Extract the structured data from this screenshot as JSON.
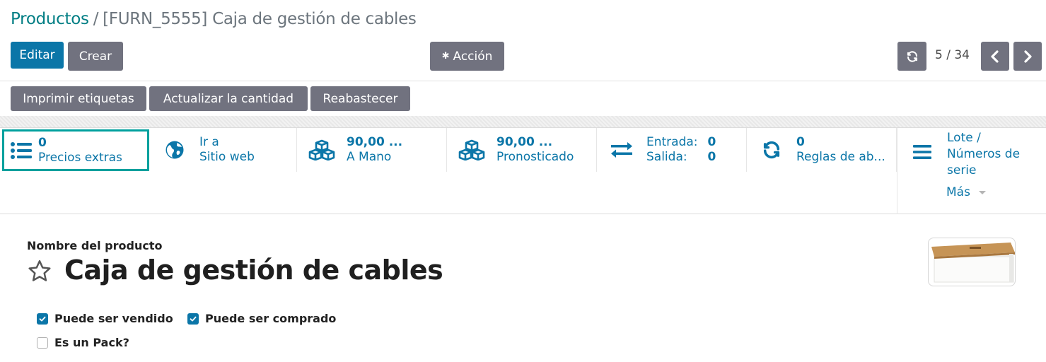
{
  "breadcrumb": {
    "parent": "Productos",
    "separator": "/",
    "current": "[FURN_5555] Caja de gestión de cables"
  },
  "toolbar": {
    "edit_label": "Editar",
    "create_label": "Crear",
    "action_label": "Acción",
    "pager": "5 / 34"
  },
  "actions": {
    "print_labels": "Imprimir etiquetas",
    "update_qty": "Actualizar la cantidad",
    "replenish": "Reabastecer"
  },
  "stats": {
    "extra_prices": {
      "value": "0",
      "label": "Precios extras",
      "icon": "list-icon"
    },
    "website": {
      "line1": "Ir a",
      "line2": "Sitio web",
      "icon": "globe-icon"
    },
    "on_hand": {
      "value": "90,00 ...",
      "label": "A Mano",
      "icon": "cubes-icon"
    },
    "forecast": {
      "value": "90,00 ...",
      "label": "Pronosticado",
      "icon": "cubes-icon"
    },
    "in_out": {
      "in_label": "Entrada:",
      "in_value": "0",
      "out_label": "Salida:",
      "out_value": "0",
      "icon": "exchange-icon"
    },
    "reorder_rules": {
      "value": "0",
      "label": "Reglas de ab...",
      "icon": "refresh-icon"
    },
    "lots": {
      "line1": "Lote /",
      "line2": "Números de",
      "line3": "serie",
      "icon": "bars-icon"
    },
    "more_label": "Más"
  },
  "form": {
    "name_label": "Nombre del producto",
    "name": "Caja de gestión de cables",
    "sale_ok": {
      "label": "Puede ser vendido",
      "checked": true
    },
    "purchase_ok": {
      "label": "Puede ser comprado",
      "checked": true
    },
    "is_pack": {
      "label": "Es un Pack?",
      "checked": false
    }
  },
  "colors": {
    "primary": "#0b76a8",
    "secondary": "#71727f",
    "highlight": "#00a09d",
    "link": "#017e84"
  }
}
